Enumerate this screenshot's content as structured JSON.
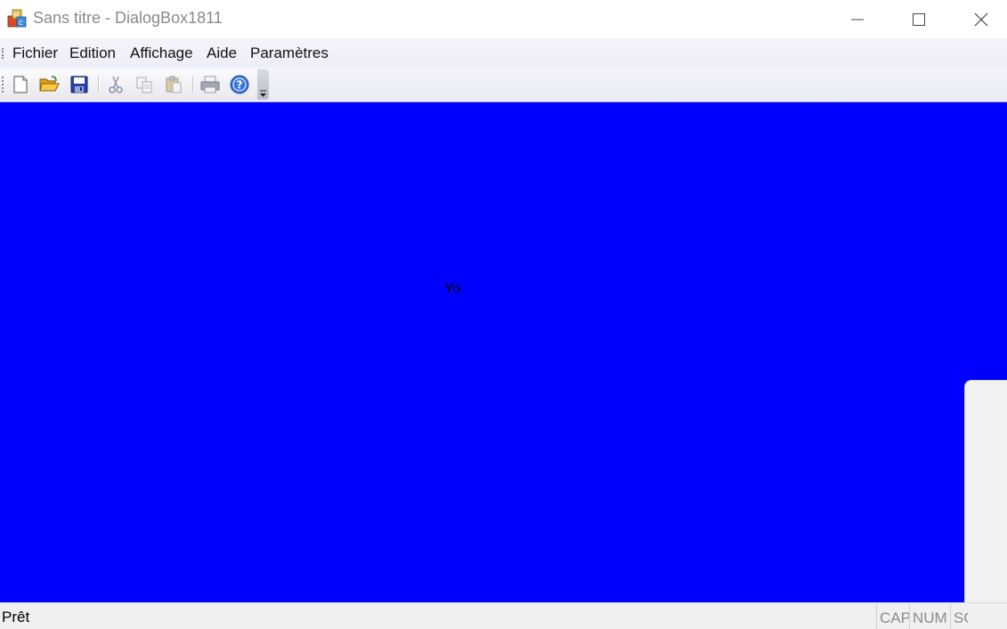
{
  "window": {
    "title": "Sans titre - DialogBox1811"
  },
  "menu": {
    "items": [
      {
        "label": "Fichier"
      },
      {
        "label": "Edition"
      },
      {
        "label": "Affichage"
      },
      {
        "label": "Aide"
      },
      {
        "label": "Paramètres"
      }
    ]
  },
  "toolbar": {
    "buttons": [
      {
        "icon": "new-document-icon"
      },
      {
        "icon": "open-folder-icon"
      },
      {
        "icon": "save-icon"
      },
      {
        "icon": "cut-icon"
      },
      {
        "icon": "copy-icon"
      },
      {
        "icon": "paste-icon"
      },
      {
        "icon": "print-icon"
      },
      {
        "icon": "help-icon"
      }
    ]
  },
  "client": {
    "text": "Yo",
    "background": "#0000ff"
  },
  "status": {
    "text": "Prêt",
    "indicators": [
      "CAP",
      "NUM",
      "SC"
    ]
  }
}
